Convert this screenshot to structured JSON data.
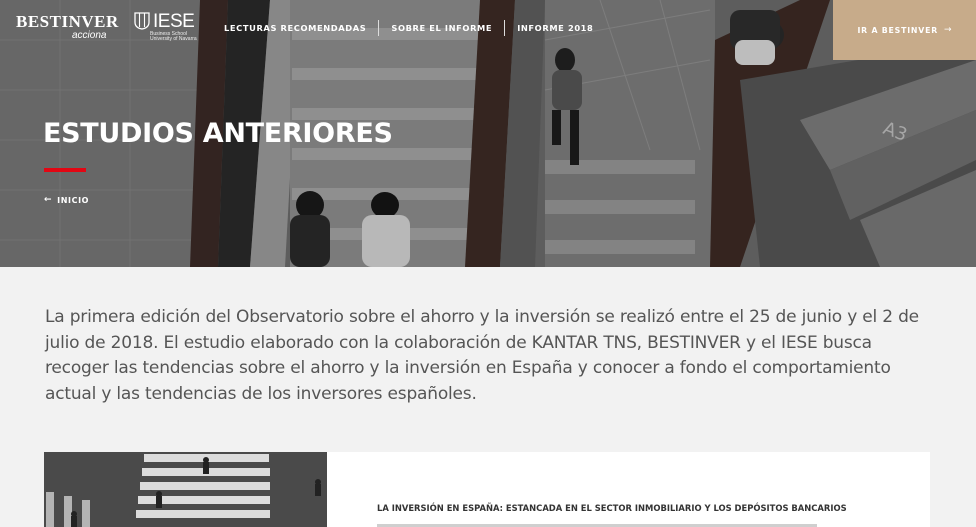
{
  "brand": {
    "bestinver": "BESTINVER",
    "acciona": "acciona",
    "iese": "IESE",
    "iese_sub": "Business School University of Navarra"
  },
  "nav": {
    "items": [
      {
        "label": "LECTURAS RECOMENDADAS"
      },
      {
        "label": "SOBRE EL INFORME"
      },
      {
        "label": "INFORME 2018"
      }
    ]
  },
  "cta": {
    "label": "IR A BESTINVER",
    "arrow_icon": "arrow-right-icon"
  },
  "hero": {
    "title": "ESTUDIOS ANTERIORES",
    "breadcrumb": "INICIO",
    "breadcrumb_icon": "arrow-left-icon"
  },
  "intro": {
    "text": "La primera edición del Observatorio sobre el ahorro y la inversión se realizó entre el 25 de junio y el 2 de julio de 2018. El estudio elaborado con la colaboración de KANTAR TNS, BESTINVER y el IESE busca recoger las tendencias sobre el ahorro y la inversión en España y conocer a fondo el comportamiento actual y las tendencias de los inversores españoles."
  },
  "card": {
    "heading": "LA INVERSIÓN EN ESPAÑA: ESTANCADA EN EL SECTOR INMOBILIARIO Y LOS DEPÓSITOS BANCARIOS"
  },
  "colors": {
    "accent_red": "#e30613",
    "cta_tan": "#c7ab8a",
    "page_bg": "#f2f2f2",
    "intro_text": "#555555"
  }
}
